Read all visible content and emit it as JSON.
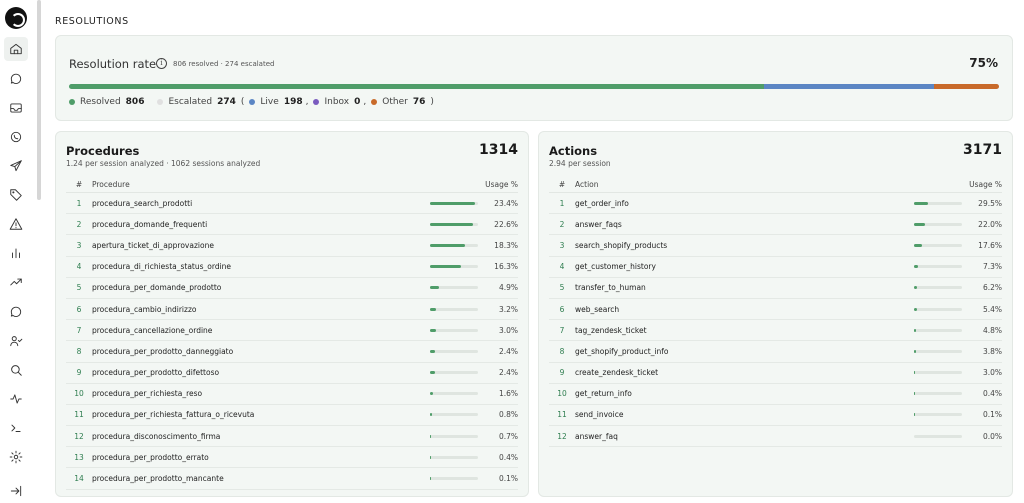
{
  "page_title": "RESOLUTIONS",
  "colors": {
    "resolved": "#4f9d69",
    "escalated": "#e0e0e0",
    "live": "#5b86c4",
    "inbox": "#7a5bbf",
    "other": "#c86a2a"
  },
  "sidebar": {
    "items": [
      {
        "name": "home-icon"
      },
      {
        "name": "chat-icon"
      },
      {
        "name": "inbox-icon"
      },
      {
        "name": "whatsapp-icon"
      },
      {
        "name": "send-icon"
      },
      {
        "name": "tag-icon"
      },
      {
        "name": "warning-icon"
      },
      {
        "name": "bar-chart-icon"
      },
      {
        "name": "trend-icon"
      },
      {
        "name": "comment-icon"
      },
      {
        "name": "users-icon"
      },
      {
        "name": "search-icon"
      },
      {
        "name": "activity-icon"
      },
      {
        "name": "terminal-icon"
      },
      {
        "name": "gear-icon"
      },
      {
        "name": "logout-icon"
      }
    ]
  },
  "resolution": {
    "label": "Resolution rate",
    "info_icon": "i",
    "sub": "806 resolved · 274 escalated",
    "pct": "75%",
    "bar": {
      "resolved": 75,
      "live": 18.3,
      "other": 7
    },
    "legend": {
      "resolved_label": "Resolved",
      "resolved_val": "806",
      "escalated_label": "Escalated",
      "escalated_val": "274",
      "open_paren": "(",
      "live_label": "Live",
      "live_val": "198",
      "inbox_label": "Inbox",
      "inbox_val": "0",
      "other_label": "Other",
      "other_val": "76",
      "sep": ",",
      "close_paren": ")"
    }
  },
  "procedures": {
    "title": "Procedures",
    "total": "1314",
    "sub": "1.24 per session analyzed · 1062 sessions analyzed",
    "headers": {
      "num": "#",
      "name": "Procedure",
      "usage": "Usage %"
    },
    "rows": [
      {
        "n": "1",
        "name": "procedura_search_prodotti",
        "pct": "23.4%",
        "v": 23.4
      },
      {
        "n": "2",
        "name": "procedura_domande_frequenti",
        "pct": "22.6%",
        "v": 22.6
      },
      {
        "n": "3",
        "name": "apertura_ticket_di_approvazione",
        "pct": "18.3%",
        "v": 18.3
      },
      {
        "n": "4",
        "name": "procedura_di_richiesta_status_ordine",
        "pct": "16.3%",
        "v": 16.3
      },
      {
        "n": "5",
        "name": "procedura_per_domande_prodotto",
        "pct": "4.9%",
        "v": 4.9
      },
      {
        "n": "6",
        "name": "procedura_cambio_indirizzo",
        "pct": "3.2%",
        "v": 3.2
      },
      {
        "n": "7",
        "name": "procedura_cancellazione_ordine",
        "pct": "3.0%",
        "v": 3.0
      },
      {
        "n": "8",
        "name": "procedura_per_prodotto_danneggiato",
        "pct": "2.4%",
        "v": 2.4
      },
      {
        "n": "9",
        "name": "procedura_per_prodotto_difettoso",
        "pct": "2.4%",
        "v": 2.4
      },
      {
        "n": "10",
        "name": "procedura_per_richiesta_reso",
        "pct": "1.6%",
        "v": 1.6
      },
      {
        "n": "11",
        "name": "procedura_per_richiesta_fattura_o_ricevuta",
        "pct": "0.8%",
        "v": 0.8
      },
      {
        "n": "12",
        "name": "procedura_disconoscimento_firma",
        "pct": "0.7%",
        "v": 0.7
      },
      {
        "n": "13",
        "name": "procedura_per_prodotto_errato",
        "pct": "0.4%",
        "v": 0.4
      },
      {
        "n": "14",
        "name": "procedura_per_prodotto_mancante",
        "pct": "0.1%",
        "v": 0.1
      }
    ]
  },
  "actions": {
    "title": "Actions",
    "total": "3171",
    "sub": "2.94 per session",
    "headers": {
      "num": "#",
      "name": "Action",
      "usage": "Usage %"
    },
    "rows": [
      {
        "n": "1",
        "name": "get_order_info",
        "pct": "29.5%",
        "v": 29.5
      },
      {
        "n": "2",
        "name": "answer_faqs",
        "pct": "22.0%",
        "v": 22.0
      },
      {
        "n": "3",
        "name": "search_shopify_products",
        "pct": "17.6%",
        "v": 17.6
      },
      {
        "n": "4",
        "name": "get_customer_history",
        "pct": "7.3%",
        "v": 7.3
      },
      {
        "n": "5",
        "name": "transfer_to_human",
        "pct": "6.2%",
        "v": 6.2
      },
      {
        "n": "6",
        "name": "web_search",
        "pct": "5.4%",
        "v": 5.4
      },
      {
        "n": "7",
        "name": "tag_zendesk_ticket",
        "pct": "4.8%",
        "v": 4.8
      },
      {
        "n": "8",
        "name": "get_shopify_product_info",
        "pct": "3.8%",
        "v": 3.8
      },
      {
        "n": "9",
        "name": "create_zendesk_ticket",
        "pct": "3.0%",
        "v": 3.0
      },
      {
        "n": "10",
        "name": "get_return_info",
        "pct": "0.4%",
        "v": 0.4
      },
      {
        "n": "11",
        "name": "send_invoice",
        "pct": "0.1%",
        "v": 0.1
      },
      {
        "n": "12",
        "name": "answer_faq",
        "pct": "0.0%",
        "v": 0.0
      }
    ]
  }
}
